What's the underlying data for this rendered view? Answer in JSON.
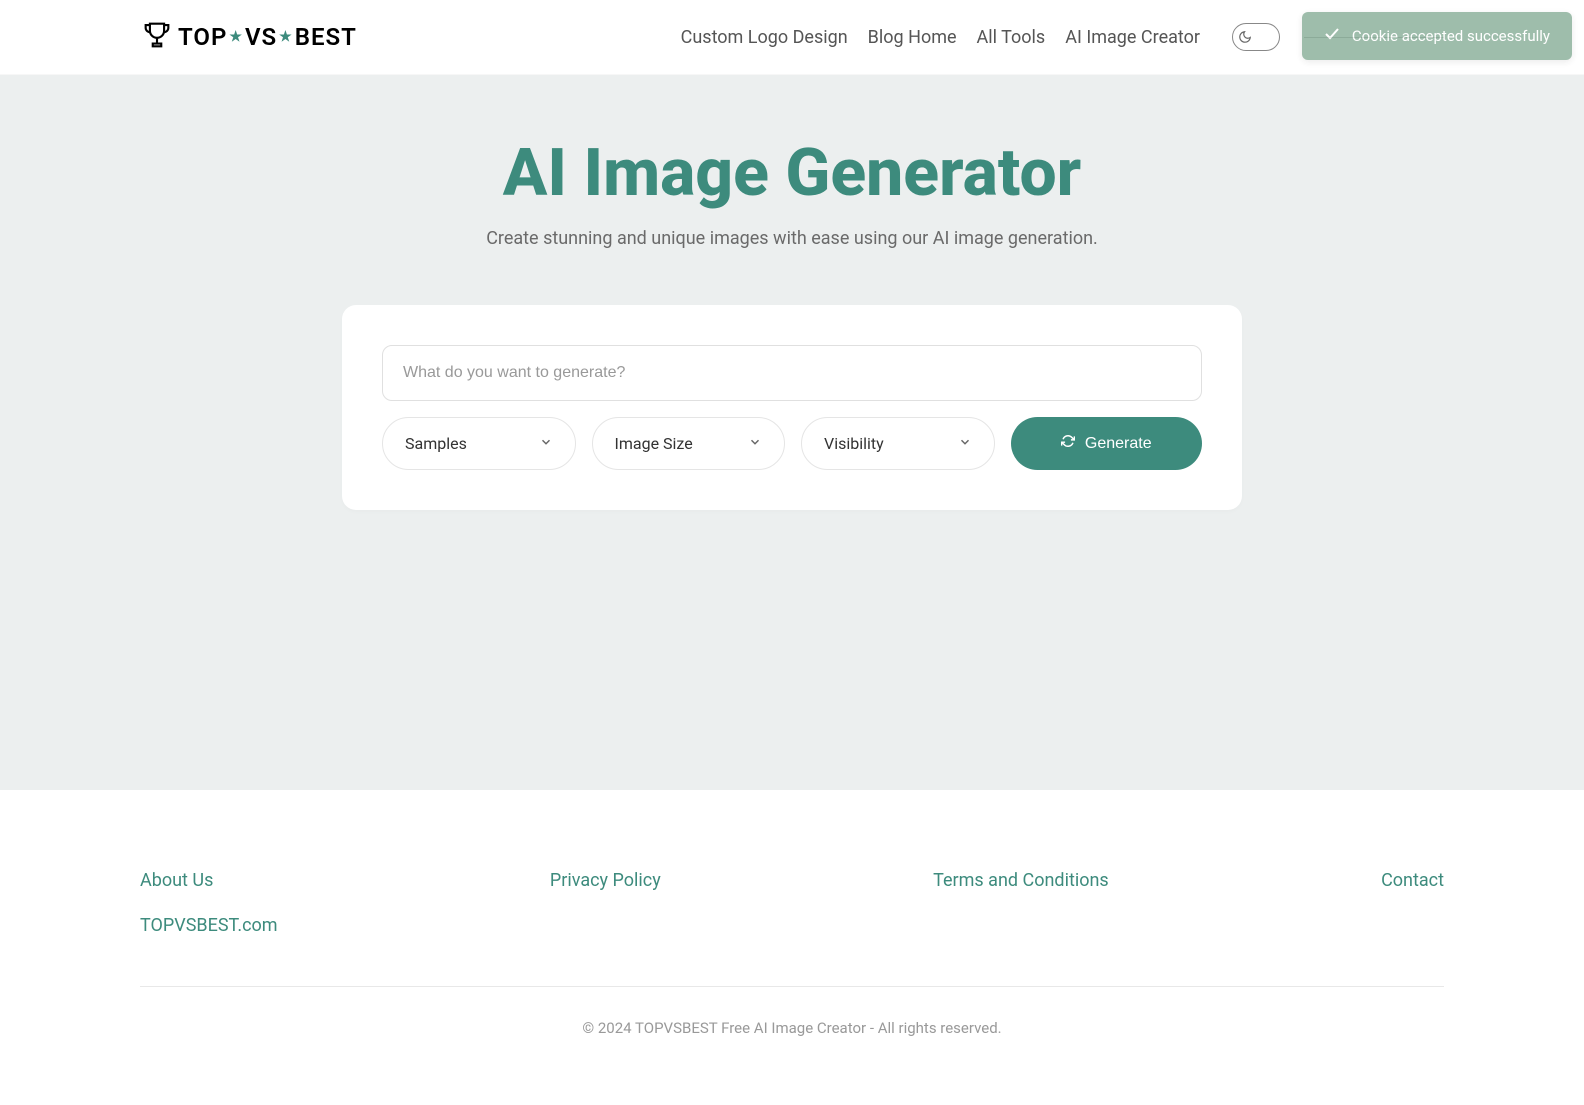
{
  "logo": {
    "text_parts": [
      "TOP",
      "VS",
      "BEST"
    ]
  },
  "nav": {
    "items": [
      "Custom Logo Design",
      "Blog Home",
      "All Tools",
      "AI Image Creator"
    ]
  },
  "hero": {
    "title": "AI Image Generator",
    "subtitle": "Create stunning and unique images with ease using our AI image generation."
  },
  "form": {
    "prompt_placeholder": "What do you want to generate?",
    "dropdowns": {
      "samples": "Samples",
      "image_size": "Image Size",
      "visibility": "Visibility"
    },
    "generate_label": "Generate"
  },
  "footer": {
    "links": {
      "about": "About Us",
      "privacy": "Privacy Policy",
      "terms": "Terms and Conditions",
      "contact": "Contact",
      "home": "TOPVSBEST.com"
    },
    "copyright": "© 2024 TOPVSBEST Free AI Image Creator - All rights reserved."
  },
  "toast": {
    "message": "Cookie accepted successfully"
  }
}
